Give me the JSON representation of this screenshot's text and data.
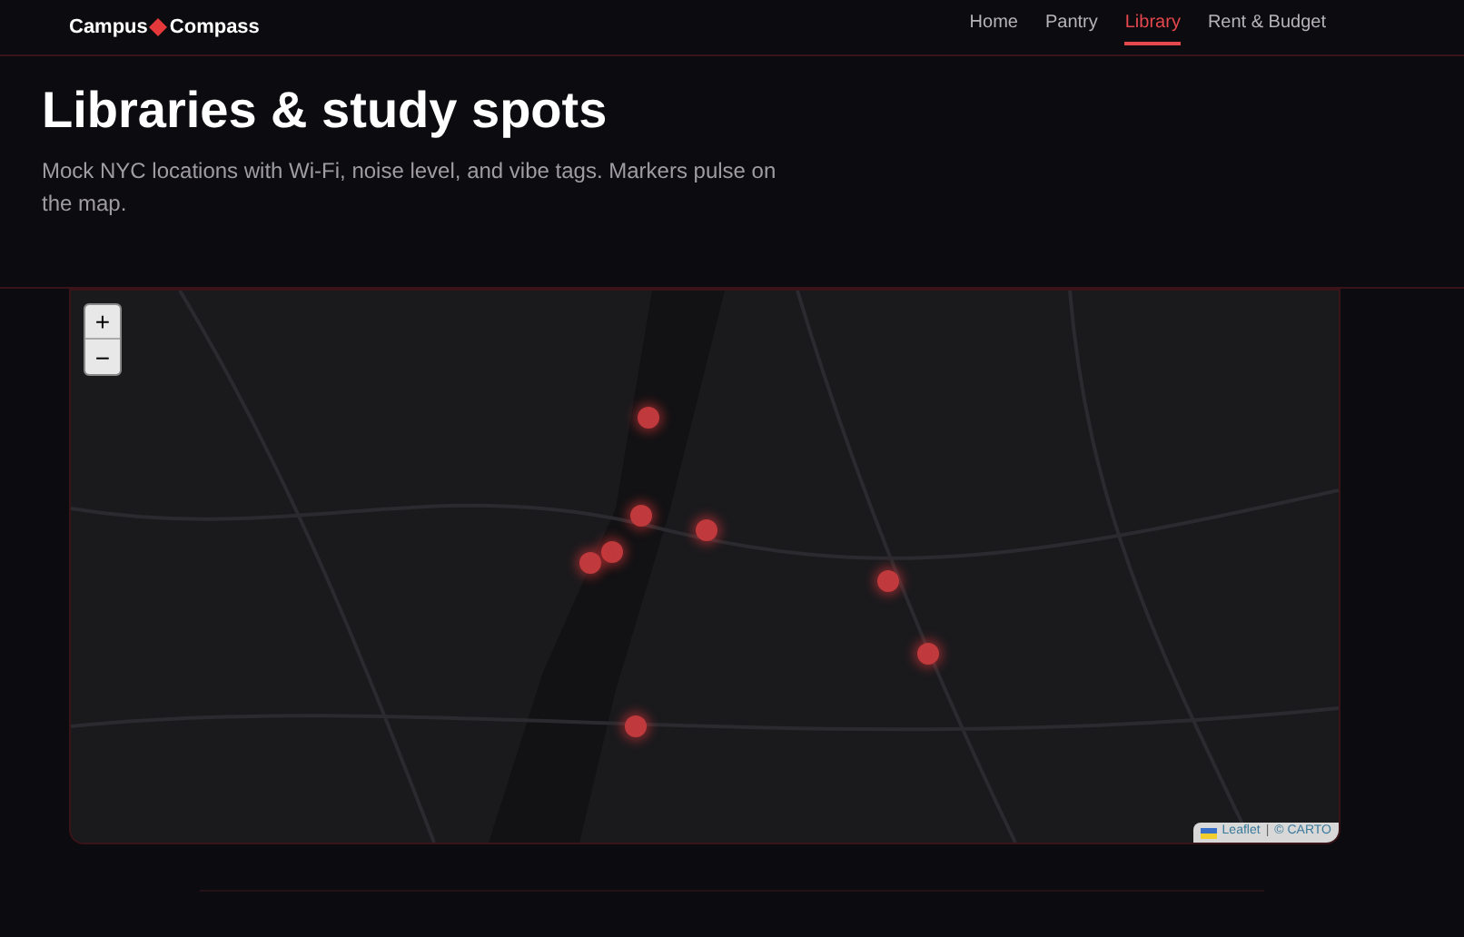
{
  "brand": {
    "left": "Campus",
    "right": "Compass"
  },
  "nav": [
    {
      "label": "Home",
      "selected": false
    },
    {
      "label": "Pantry",
      "selected": false
    },
    {
      "label": "Library",
      "selected": true
    },
    {
      "label": "Rent & Budget",
      "selected": false
    }
  ],
  "hero": {
    "title": "Libraries & study spots",
    "subtitle": "Mock NYC locations with Wi-Fi, noise level, and vibe tags. Markers pulse on the map."
  },
  "map": {
    "zoom_in": "+",
    "zoom_out": "−",
    "attribution": {
      "library": "Leaflet",
      "separator": "|",
      "provider": "© CARTO"
    }
  }
}
